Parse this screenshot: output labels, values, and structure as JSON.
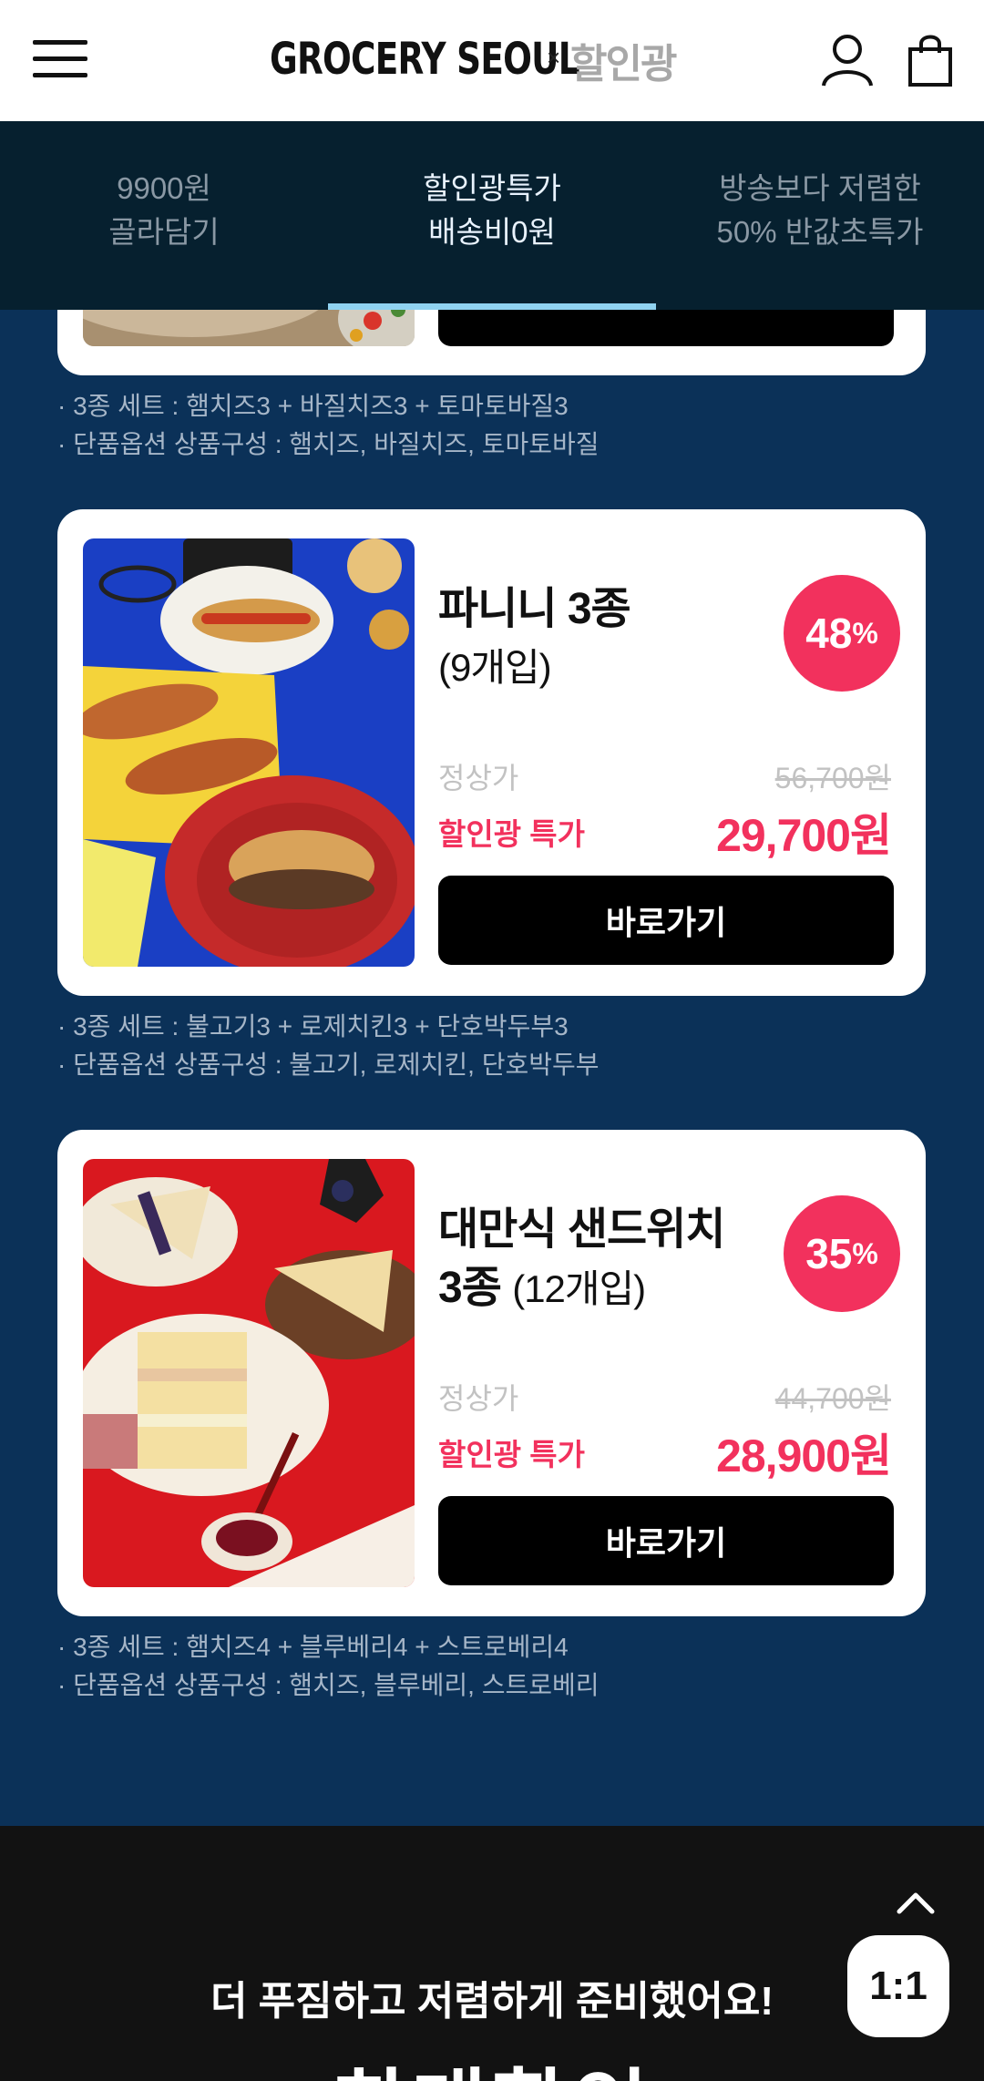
{
  "header": {
    "brand": "GROCERY SEOUL",
    "brand_x": "×",
    "brand_sub": "할인광"
  },
  "categories": [
    {
      "line1": "9900원",
      "line2": "골라담기",
      "active": false
    },
    {
      "line1": "할인광특가",
      "line2": "배송비0원",
      "active": true
    },
    {
      "line1": "방송보다 저렴한",
      "line2": "50% 반값초특가",
      "active": false
    }
  ],
  "prev_card": {
    "notes": [
      "· 3종 세트 : 햄치즈3 + 바질치즈3 + 토마토바질3",
      "· 단품옵션 상품구성 : 햄치즈, 바질치즈, 토마토바질"
    ]
  },
  "products": [
    {
      "name": "파니니 3종",
      "sub": "(9개입)",
      "discount": "48",
      "discount_unit": "%",
      "regular_label": "정상가",
      "regular_price": "56,700원",
      "sale_label": "할인광 특가",
      "sale_price": "29,700원",
      "button": "바로가기",
      "notes": [
        "· 3종 세트 : 불고기3 + 로제치킨3 + 단호박두부3",
        "· 단품옵션 상품구성 : 불고기, 로제치킨, 단호박두부"
      ]
    },
    {
      "name": "대만식 샌드위치",
      "name2": "3종",
      "sub": "(12개입)",
      "discount": "35",
      "discount_unit": "%",
      "regular_label": "정상가",
      "regular_price": "44,700원",
      "sale_label": "할인광 특가",
      "sale_price": "28,900원",
      "button": "바로가기",
      "notes": [
        "· 3종 세트 : 햄치즈4 + 블루베리4 + 스트로베리4",
        "· 단품옵션 상품구성 : 햄치즈, 블루베리, 스트로베리"
      ]
    }
  ],
  "footer": {
    "headline": "더 푸짐하고 저렴하게 준비했어요!",
    "big": "최대할인",
    "ratio_button": "1:1"
  },
  "icons": {
    "menu": "hamburger-icon",
    "user": "user-icon",
    "cart": "shopping-bag-icon",
    "top": "chevron-up-icon"
  },
  "colors": {
    "accent": "#f2315d",
    "page_bg": "#0b3158",
    "nav_bg": "#06202f",
    "indicator": "#8fd2f0"
  }
}
